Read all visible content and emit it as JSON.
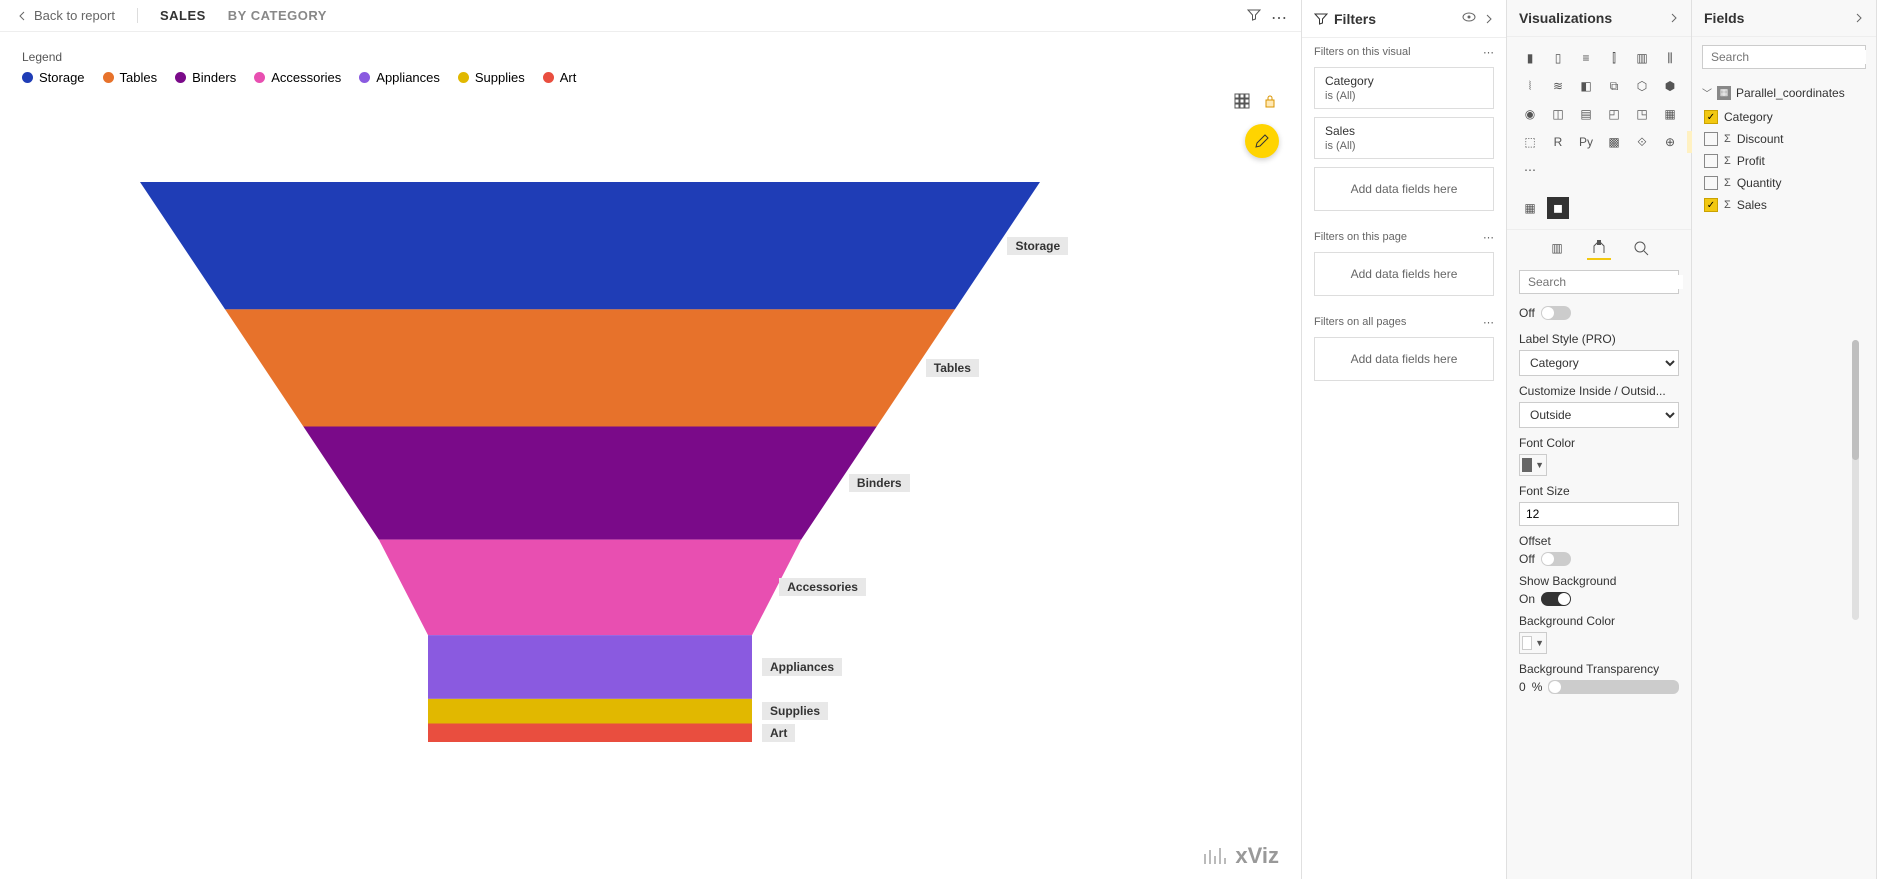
{
  "header": {
    "back": "Back to report",
    "breadcrumbs": [
      {
        "label": "SALES",
        "active": true
      },
      {
        "label": "BY CATEGORY",
        "active": false
      }
    ]
  },
  "legend": {
    "title": "Legend",
    "items": [
      {
        "label": "Storage",
        "color": "#1f3db6"
      },
      {
        "label": "Tables",
        "color": "#e7722b"
      },
      {
        "label": "Binders",
        "color": "#7a0a89"
      },
      {
        "label": "Accessories",
        "color": "#e84fb1"
      },
      {
        "label": "Appliances",
        "color": "#8a5ae0"
      },
      {
        "label": "Supplies",
        "color": "#e1b800"
      },
      {
        "label": "Art",
        "color": "#e94e3f"
      }
    ]
  },
  "chart_data": {
    "type": "funnel",
    "title": "Sales by Category",
    "series": [
      {
        "name": "Storage",
        "value": 124,
        "color": "#1f3db6"
      },
      {
        "name": "Tables",
        "value": 114,
        "color": "#e7722b"
      },
      {
        "name": "Binders",
        "value": 110,
        "color": "#7a0a89"
      },
      {
        "name": "Accessories",
        "value": 93,
        "color": "#e84fb1"
      },
      {
        "name": "Appliances",
        "value": 62,
        "color": "#8a5ae0"
      },
      {
        "name": "Supplies",
        "value": 24,
        "color": "#e1b800"
      },
      {
        "name": "Art",
        "value": 18,
        "color": "#e94e3f"
      }
    ]
  },
  "brand": "xViz",
  "filters": {
    "title": "Filters",
    "sections": [
      {
        "title": "Filters on this visual",
        "cards": [
          {
            "name": "Category",
            "value": "is (All)"
          },
          {
            "name": "Sales",
            "value": "is (All)"
          }
        ],
        "add": "Add data fields here"
      },
      {
        "title": "Filters on this page",
        "cards": [],
        "add": "Add data fields here"
      },
      {
        "title": "Filters on all pages",
        "cards": [],
        "add": "Add data fields here"
      }
    ]
  },
  "viz": {
    "title": "Visualizations",
    "search": "Search",
    "format_tab": {
      "off_label": "Off",
      "label_style": {
        "label": "Label Style (PRO)",
        "value": "Category"
      },
      "customize": {
        "label": "Customize Inside / Outsid...",
        "value": "Outside"
      },
      "font_color": {
        "label": "Font Color",
        "value": "#666666"
      },
      "font_size": {
        "label": "Font Size",
        "value": "12"
      },
      "offset": {
        "label": "Offset",
        "state": "Off"
      },
      "show_bg": {
        "label": "Show Background",
        "state": "On"
      },
      "bg_color": {
        "label": "Background Color",
        "value": "#ffffff"
      },
      "bg_trans": {
        "label": "Background Transparency",
        "value": "0",
        "unit": "%"
      }
    }
  },
  "fields": {
    "title": "Fields",
    "search": "Search",
    "table": "Parallel_coordinates",
    "items": [
      {
        "label": "Category",
        "checked": true,
        "sigma": false
      },
      {
        "label": "Discount",
        "checked": false,
        "sigma": true
      },
      {
        "label": "Profit",
        "checked": false,
        "sigma": true
      },
      {
        "label": "Quantity",
        "checked": false,
        "sigma": true
      },
      {
        "label": "Sales",
        "checked": true,
        "sigma": true
      }
    ]
  }
}
